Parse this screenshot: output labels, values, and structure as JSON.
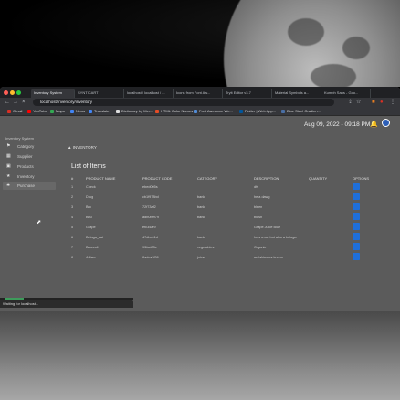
{
  "browser": {
    "tabs": [
      {
        "label": "Inventory System",
        "active": true
      },
      {
        "label": "SYNTICART",
        "active": false
      },
      {
        "label": "localhost / localhost / ...",
        "active": false
      },
      {
        "label": "Icons from Font Aw...",
        "active": false
      },
      {
        "label": "Tryit Editor v3.7",
        "active": false
      },
      {
        "label": "Material Symbols a...",
        "active": false
      },
      {
        "label": "Kumbh Sans - Goo...",
        "active": false
      }
    ],
    "url": "localhost/Inventory/inventory",
    "bookmarks": [
      {
        "label": "Gmail",
        "color": "#d93025"
      },
      {
        "label": "YouTube",
        "color": "#ff0000"
      },
      {
        "label": "Maps",
        "color": "#34a853"
      },
      {
        "label": "News",
        "color": "#4285f4"
      },
      {
        "label": "Translate",
        "color": "#4285f4"
      },
      {
        "label": "Dictionary by Mer...",
        "color": "#dddddd"
      },
      {
        "label": "HTML Color Names",
        "color": "#e34c26"
      },
      {
        "label": "Font Awesome We...",
        "color": "#528dd7"
      },
      {
        "label": "Flutter | Web App...",
        "color": "#02569b"
      },
      {
        "label": "Blue Steel Gradien...",
        "color": "#4a6fa5"
      }
    ]
  },
  "header": {
    "datetime": "Aug 09, 2022 - 09:18 PM"
  },
  "sidebar": {
    "title": "Inventory System",
    "items": [
      {
        "label": "Category",
        "icon": "category-icon",
        "active": false
      },
      {
        "label": "Supplier",
        "icon": "supplier-icon",
        "active": false
      },
      {
        "label": "Products",
        "icon": "products-icon",
        "active": false
      },
      {
        "label": "Inventory",
        "icon": "inventory-icon",
        "active": false
      },
      {
        "label": "Purchase",
        "icon": "purchase-icon",
        "active": true
      }
    ]
  },
  "main": {
    "breadcrumb": "INVENTORY",
    "list_title": "List of Items",
    "columns": [
      "#",
      "PRODUCT NAME",
      "PRODUCT CODE",
      "CATEGORY",
      "DESCRIPTION",
      "QUANTITY",
      "OPTIONS"
    ],
    "rows": [
      {
        "num": "1",
        "name": "Check",
        "code": "ebed005s",
        "category": "",
        "description": "dfs"
      },
      {
        "num": "2",
        "name": "Drug",
        "code": "cb1f978bd",
        "category": "bank",
        "description": "he a dawg"
      },
      {
        "num": "3",
        "name": "Bro",
        "code": "72f73af2",
        "category": "bank",
        "description": "bleen"
      },
      {
        "num": "4",
        "name": "Bbu",
        "code": "adb0b9f79",
        "category": "bank",
        "description": "blush"
      },
      {
        "num": "5",
        "name": "Grape",
        "code": "efc34af9",
        "category": "",
        "description": "Grape Juice Blue"
      },
      {
        "num": "6",
        "name": "Beluga_cat",
        "code": "47dbe01d",
        "category": "bank",
        "description": "he s a cat but also a beluga"
      },
      {
        "num": "7",
        "name": "Broccoli",
        "code": "93fad03c",
        "category": "vegetables",
        "description": "Organic"
      },
      {
        "num": "8",
        "name": "Adlaw",
        "code": "8adca2f36",
        "category": "juice",
        "description": "malakino na kuduo"
      }
    ]
  },
  "status_bar": "Waiting for localhost..."
}
